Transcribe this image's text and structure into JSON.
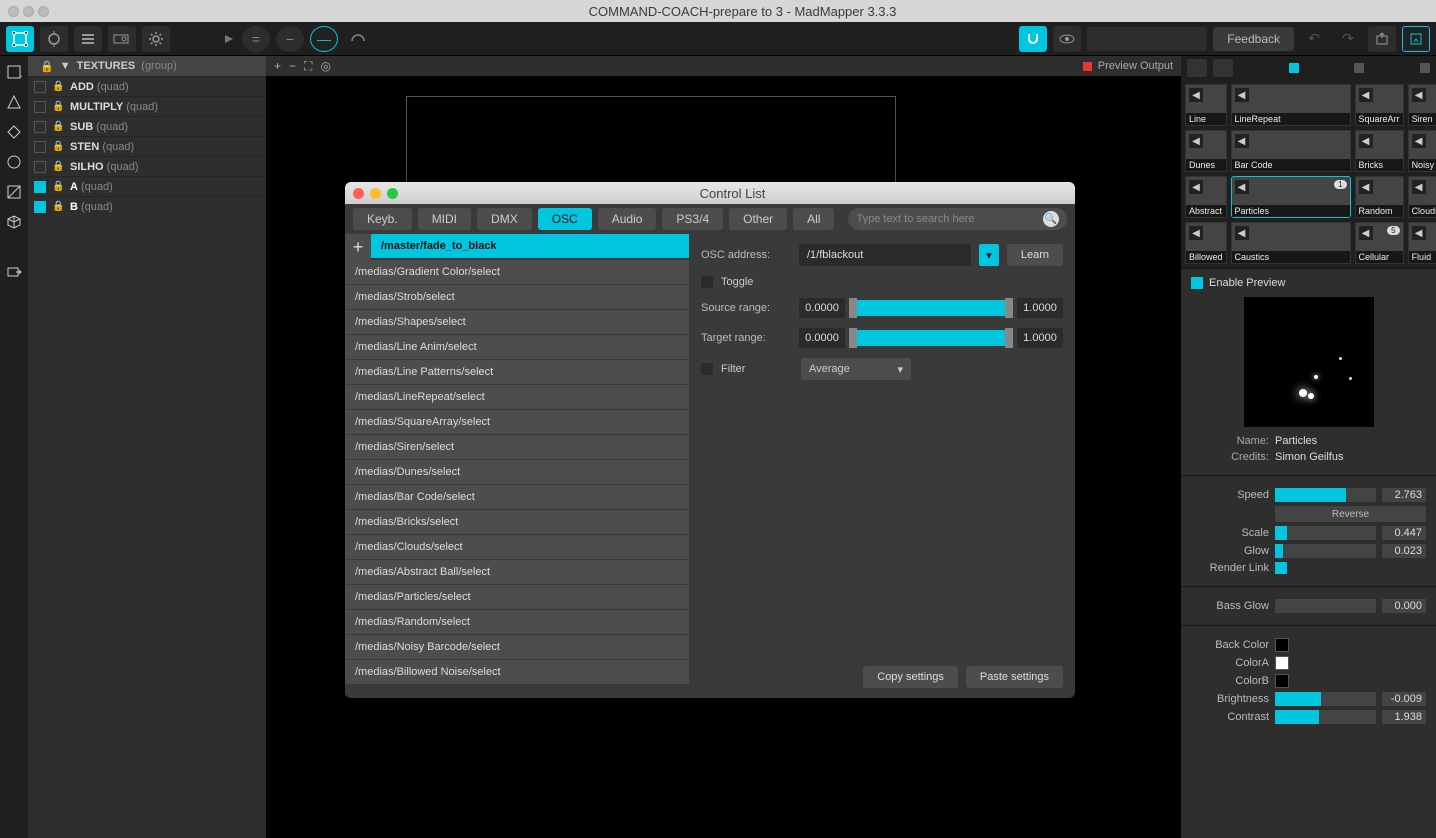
{
  "window_title": "COMMAND-COACH-prepare to 3 - MadMapper 3.3.3",
  "toolbar": {
    "feedback": "Feedback"
  },
  "layers": {
    "group_name": "TEXTURES",
    "group_type": "(group)",
    "items": [
      {
        "name": "ADD",
        "type": "(quad)",
        "on": false
      },
      {
        "name": "MULTIPLY",
        "type": "(quad)",
        "on": false
      },
      {
        "name": "SUB",
        "type": "(quad)",
        "on": false
      },
      {
        "name": "STEN",
        "type": "(quad)",
        "on": false
      },
      {
        "name": "SILHO",
        "type": "(quad)",
        "on": false
      },
      {
        "name": "A",
        "type": "(quad)",
        "on": true
      },
      {
        "name": "B",
        "type": "(quad)",
        "on": true
      }
    ]
  },
  "canvas": {
    "preview_output": "Preview Output"
  },
  "modal": {
    "title": "Control List",
    "tabs": [
      "Keyb.",
      "MIDI",
      "DMX",
      "OSC",
      "Audio",
      "PS3/4",
      "Other",
      "All"
    ],
    "active_tab": "OSC",
    "search_placeholder": "Type text to search here",
    "add": "+",
    "list": [
      "/master/fade_to_black",
      "/medias/Gradient Color/select",
      "/medias/Strob/select",
      "/medias/Shapes/select",
      "/medias/Line Anim/select",
      "/medias/Line Patterns/select",
      "/medias/LineRepeat/select",
      "/medias/SquareArray/select",
      "/medias/Siren/select",
      "/medias/Dunes/select",
      "/medias/Bar Code/select",
      "/medias/Bricks/select",
      "/medias/Clouds/select",
      "/medias/Abstract Ball/select",
      "/medias/Particles/select",
      "/medias/Random/select",
      "/medias/Noisy Barcode/select",
      "/medias/Billowed Noise/select"
    ],
    "selected_index": 0,
    "detail": {
      "osc_address_label": "OSC address:",
      "osc_address": "/1/fblackout",
      "learn": "Learn",
      "toggle": "Toggle",
      "source_range": "Source range:",
      "target_range": "Target range:",
      "r_min": "0.0000",
      "r_max": "1.0000",
      "filter": "Filter",
      "filter_value": "Average",
      "copy": "Copy settings",
      "paste": "Paste settings"
    }
  },
  "library": {
    "thumbs": [
      {
        "label": "Line"
      },
      {
        "label": "LineRepeat"
      },
      {
        "label": "SquareArr"
      },
      {
        "label": "Siren"
      },
      {
        "label": "Dunes"
      },
      {
        "label": "Bar Code"
      },
      {
        "label": "Bricks"
      },
      {
        "label": "Noisy"
      },
      {
        "label": "Abstract"
      },
      {
        "label": "Particles",
        "selected": true,
        "badge": "1"
      },
      {
        "label": "Random"
      },
      {
        "label": "Clouds"
      },
      {
        "label": "Billowed"
      },
      {
        "label": "Caustics"
      },
      {
        "label": "Cellular",
        "badge": "5"
      },
      {
        "label": "Fluid"
      }
    ]
  },
  "inspector": {
    "enable_preview": "Enable Preview",
    "name_label": "Name:",
    "name": "Particles",
    "credits_label": "Credits:",
    "credits": "Simon Geilfus",
    "params": [
      {
        "k": "Speed",
        "v": "2.763",
        "fill": 70
      },
      {
        "k": "Scale",
        "v": "0.447",
        "fill": 12
      },
      {
        "k": "Glow",
        "v": "0.023",
        "fill": 8
      }
    ],
    "reverse": "Reverse",
    "render_link": "Render Link",
    "bass_glow": {
      "k": "Bass Glow",
      "v": "0.000",
      "fill": 0
    },
    "back_color": "Back Color",
    "color_a": "ColorA",
    "color_b": "ColorB",
    "brightness": {
      "k": "Brightness",
      "v": "-0.009",
      "fill": 46
    },
    "contrast": {
      "k": "Contrast",
      "v": "1.938",
      "fill": 44
    }
  }
}
